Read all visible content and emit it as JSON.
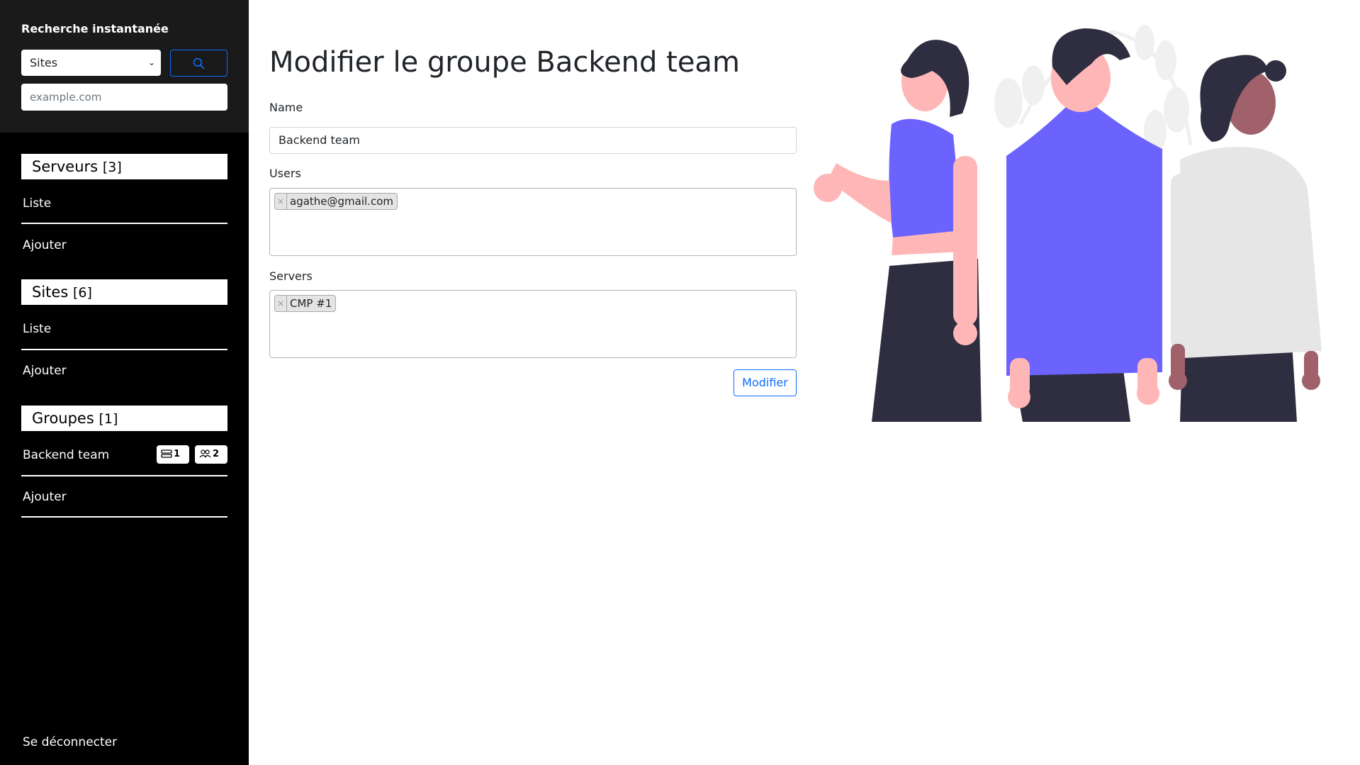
{
  "sidebar": {
    "search": {
      "title": "Recherche instantanée",
      "select_value": "Sites",
      "input_placeholder": "example.com"
    },
    "sections": [
      {
        "title": "Serveurs",
        "count": "[3]",
        "items": [
          "Liste",
          "Ajouter"
        ]
      },
      {
        "title": "Sites",
        "count": "[6]",
        "items": [
          "Liste",
          "Ajouter"
        ]
      },
      {
        "title": "Groupes",
        "count": "[1]",
        "items": [
          "Backend team",
          "Ajouter"
        ]
      }
    ],
    "group_badges": {
      "servers": "1",
      "users": "2"
    },
    "logout": "Se déconnecter"
  },
  "main": {
    "title": "Modifier le groupe Backend team",
    "name_label": "Name",
    "name_value": "Backend team",
    "users_label": "Users",
    "users": [
      "agathe@gmail.com"
    ],
    "servers_label": "Servers",
    "servers": [
      "CMP #1"
    ],
    "tag_remove": "×",
    "submit_label": "Modifier"
  },
  "colors": {
    "accent": "#0d6efd",
    "illustration_primary": "#6c63ff",
    "illustration_dark": "#2f2e41",
    "illustration_skin": "#ffb6b6"
  }
}
